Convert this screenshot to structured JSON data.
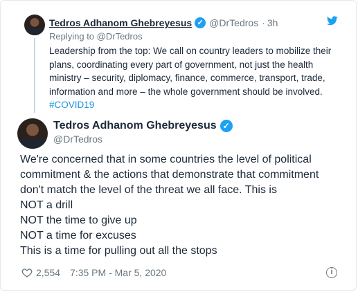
{
  "reply": {
    "name": "Tedros Adhanom Ghebreyesus",
    "verified_icon": "verified-badge-icon",
    "handle": "@DrTedros",
    "separator": "·",
    "time": "3h",
    "replying_to": "Replying to @DrTedros",
    "text": "Leadership from the top: We call on country leaders to mobilize their plans, coordinating every part of government, not just the health ministry – security, diplomacy, finance, commerce, transport, trade, information and more – the whole government should be involved.",
    "hashtag": "#COVID19"
  },
  "tweet": {
    "name": "Tedros Adhanom Ghebreyesus",
    "handle": "@DrTedros",
    "lines": [
      "We're concerned that in some countries the level of political",
      "commitment & the actions that demonstrate that commitment",
      "don't match the level of the threat we all face. This is",
      "NOT a drill",
      "NOT the time to give up",
      "NOT a time for excuses",
      "This is a time for pulling out all the stops"
    ],
    "likes": "2,554",
    "timestamp": "7:35 PM - Mar 5, 2020"
  },
  "colors": {
    "accent": "#1da1f2",
    "hashtag": "#1b95e0",
    "text": "#1c2938",
    "muted": "#697882"
  },
  "icons": {
    "brand": "twitter-bird-icon",
    "like": "heart-icon",
    "info": "info-icon"
  }
}
